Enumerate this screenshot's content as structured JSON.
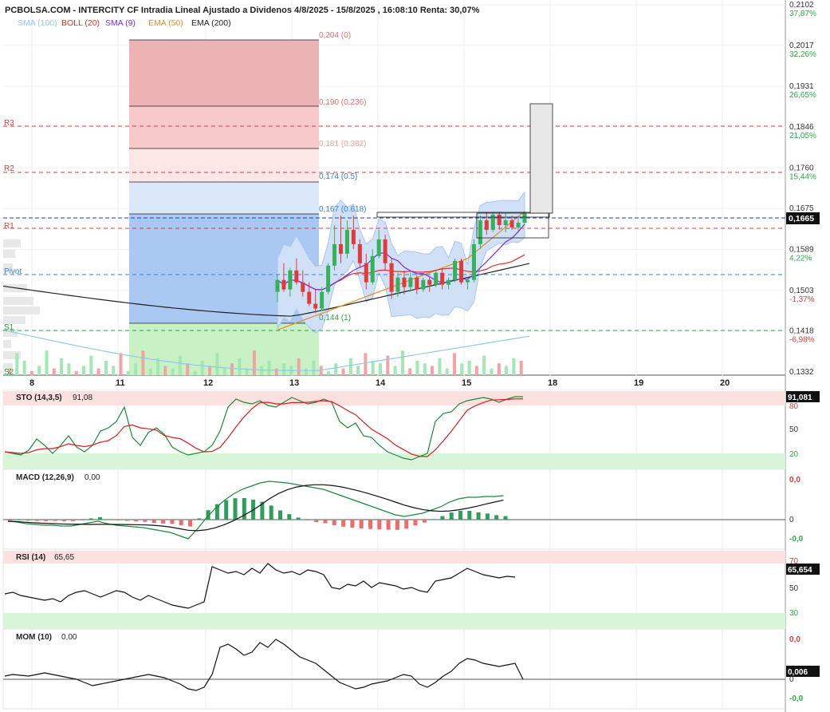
{
  "chart_data": {
    "type": "candlestick",
    "title": "PCBOLSA.COM - INTERCITY CF Intradia Lineal Ajustado a Dividenos 4/8/2025 - 15/8/2025 , 16:08:10 Renta: 30,07%",
    "legend": [
      {
        "label": "SMA (100)",
        "color": "#8ec9ee"
      },
      {
        "label": "BOLL (20)",
        "color": "#e0302a"
      },
      {
        "label": "SMA (9)",
        "color": "#7a2ee0"
      },
      {
        "label": "EMA (50)",
        "color": "#e88a28"
      },
      {
        "label": "EMA (200)",
        "color": "#222222"
      }
    ],
    "x_ticks": [
      "8",
      "11",
      "12",
      "13",
      "14",
      "15",
      "18",
      "19",
      "20"
    ],
    "price_ticks": [
      {
        "price": "0,2102",
        "pct": "37,87%"
      },
      {
        "price": "0,2017",
        "pct": "32,26%"
      },
      {
        "price": "0,1931",
        "pct": "26,65%"
      },
      {
        "price": "0,1846",
        "pct": "21,05%"
      },
      {
        "price": "0,1760",
        "pct": "15,44%"
      },
      {
        "price": "0,1675",
        "pct": ""
      },
      {
        "price": "0,1589",
        "pct": "4,22%"
      },
      {
        "price": "0,1503",
        "pct": "-1,37%"
      },
      {
        "price": "0,1418",
        "pct": "-6,98%"
      },
      {
        "price": "0,1332",
        "pct": ""
      }
    ],
    "last_price": "0,1665",
    "pivots": {
      "R3": "R3",
      "R2": "R2",
      "R1": "R1",
      "Pivot": "Pivot",
      "S1": "S1",
      "S2": "S2"
    },
    "fib_labels": [
      "0,204 (0)",
      "0,190 (0.236)",
      "0,181 (0.382)",
      "0,174 (0.5)",
      "0,167 (0.618)",
      "0,144 (1)"
    ],
    "candles": [
      {
        "o": 0.15,
        "h": 0.1535,
        "l": 0.1478,
        "c": 0.1525
      },
      {
        "o": 0.1525,
        "h": 0.156,
        "l": 0.15,
        "c": 0.1505
      },
      {
        "o": 0.1505,
        "h": 0.155,
        "l": 0.149,
        "c": 0.1545
      },
      {
        "o": 0.1545,
        "h": 0.157,
        "l": 0.1515,
        "c": 0.152
      },
      {
        "o": 0.152,
        "h": 0.1545,
        "l": 0.149,
        "c": 0.15
      },
      {
        "o": 0.15,
        "h": 0.152,
        "l": 0.147,
        "c": 0.1475
      },
      {
        "o": 0.1475,
        "h": 0.1505,
        "l": 0.1455,
        "c": 0.1465
      },
      {
        "o": 0.1465,
        "h": 0.151,
        "l": 0.146,
        "c": 0.15
      },
      {
        "o": 0.15,
        "h": 0.156,
        "l": 0.1495,
        "c": 0.1555
      },
      {
        "o": 0.1555,
        "h": 0.164,
        "l": 0.1545,
        "c": 0.16
      },
      {
        "o": 0.16,
        "h": 0.166,
        "l": 0.156,
        "c": 0.158
      },
      {
        "o": 0.158,
        "h": 0.165,
        "l": 0.157,
        "c": 0.163
      },
      {
        "o": 0.163,
        "h": 0.166,
        "l": 0.159,
        "c": 0.16
      },
      {
        "o": 0.16,
        "h": 0.161,
        "l": 0.155,
        "c": 0.156
      },
      {
        "o": 0.156,
        "h": 0.158,
        "l": 0.1505,
        "c": 0.152
      },
      {
        "o": 0.152,
        "h": 0.159,
        "l": 0.1515,
        "c": 0.1575
      },
      {
        "o": 0.1575,
        "h": 0.163,
        "l": 0.157,
        "c": 0.161
      },
      {
        "o": 0.161,
        "h": 0.162,
        "l": 0.1545,
        "c": 0.156
      },
      {
        "o": 0.156,
        "h": 0.157,
        "l": 0.1485,
        "c": 0.15
      },
      {
        "o": 0.15,
        "h": 0.154,
        "l": 0.149,
        "c": 0.153
      },
      {
        "o": 0.153,
        "h": 0.1545,
        "l": 0.1495,
        "c": 0.151
      },
      {
        "o": 0.151,
        "h": 0.154,
        "l": 0.15,
        "c": 0.153
      },
      {
        "o": 0.153,
        "h": 0.1535,
        "l": 0.1495,
        "c": 0.1505
      },
      {
        "o": 0.1505,
        "h": 0.153,
        "l": 0.15,
        "c": 0.1525
      },
      {
        "o": 0.1525,
        "h": 0.153,
        "l": 0.15,
        "c": 0.1515
      },
      {
        "o": 0.1515,
        "h": 0.1545,
        "l": 0.151,
        "c": 0.154
      },
      {
        "o": 0.154,
        "h": 0.155,
        "l": 0.1505,
        "c": 0.1515
      },
      {
        "o": 0.1515,
        "h": 0.153,
        "l": 0.1505,
        "c": 0.1525
      },
      {
        "o": 0.1525,
        "h": 0.157,
        "l": 0.152,
        "c": 0.1565
      },
      {
        "o": 0.1565,
        "h": 0.157,
        "l": 0.1515,
        "c": 0.152
      },
      {
        "o": 0.152,
        "h": 0.153,
        "l": 0.1505,
        "c": 0.1525
      },
      {
        "o": 0.1525,
        "h": 0.161,
        "l": 0.152,
        "c": 0.16
      },
      {
        "o": 0.16,
        "h": 0.166,
        "l": 0.159,
        "c": 0.165
      },
      {
        "o": 0.165,
        "h": 0.1668,
        "l": 0.162,
        "c": 0.163
      },
      {
        "o": 0.163,
        "h": 0.1668,
        "l": 0.1625,
        "c": 0.1662
      },
      {
        "o": 0.1662,
        "h": 0.1668,
        "l": 0.163,
        "c": 0.164
      },
      {
        "o": 0.164,
        "h": 0.1665,
        "l": 0.1625,
        "c": 0.165
      },
      {
        "o": 0.165,
        "h": 0.166,
        "l": 0.163,
        "c": 0.1635
      },
      {
        "o": 0.1635,
        "h": 0.1655,
        "l": 0.1628,
        "c": 0.1645
      },
      {
        "o": 0.1645,
        "h": 0.1668,
        "l": 0.164,
        "c": 0.1665
      }
    ],
    "volume": [
      2,
      8,
      5,
      1,
      3,
      9,
      2,
      6,
      4,
      1,
      3,
      7,
      2,
      5,
      3,
      8,
      1,
      4,
      9,
      2,
      6,
      3,
      2,
      7,
      4,
      1,
      5,
      3,
      8,
      2,
      4,
      6,
      2,
      9,
      3,
      5,
      2,
      4,
      3,
      6,
      2,
      5,
      3,
      1,
      4,
      2,
      6,
      3,
      8,
      5,
      4,
      7,
      3,
      9,
      2,
      5,
      4,
      3,
      6,
      2,
      8,
      4,
      5,
      3,
      7,
      2,
      4,
      3,
      6,
      5
    ],
    "indicators": {
      "sto": {
        "label": "STO (14,3,5)",
        "value_text": "91,08",
        "last": "91,081",
        "levels": [
          "80",
          "50",
          "20"
        ]
      },
      "macd": {
        "label": "MACD (12,26,9)",
        "value_text": "0,00",
        "levels": [
          "0,0",
          "0",
          "-0,0"
        ]
      },
      "rsi": {
        "label": "RSI (14)",
        "value_text": "65,65",
        "last": "65,654",
        "levels": [
          "70",
          "50",
          "30"
        ]
      },
      "mom": {
        "label": "MOM (10)",
        "value_text": "0,00",
        "last": "0,006",
        "levels": [
          "0,0",
          "0",
          "-0,0"
        ]
      }
    }
  }
}
